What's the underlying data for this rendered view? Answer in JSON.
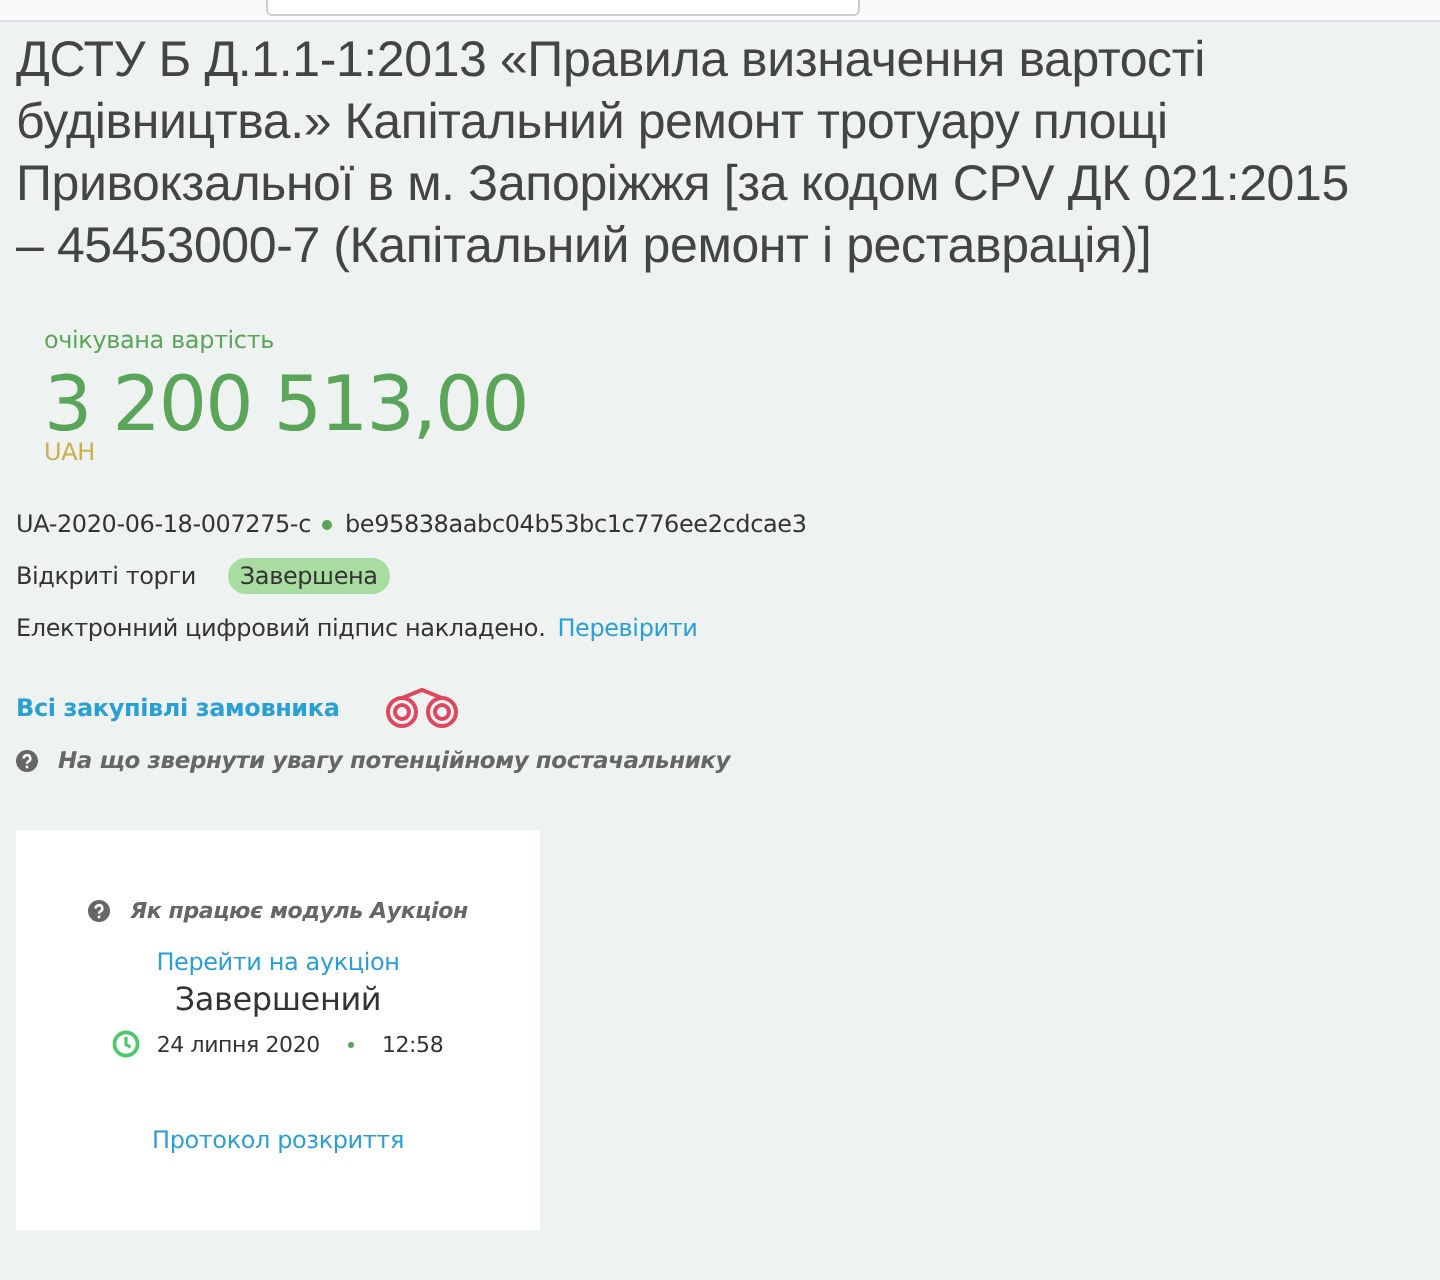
{
  "title": "ДСТУ Б Д.1.1-1:2013 «Правила визначення вартості будівництва.» Капітальний ремонт тротуару площі Привокзальної в м. Запоріжжя [за кодом CPV ДК 021:2015 – 45453000-7 (Капітальний ремонт і реставрація)]",
  "value": {
    "label": "очікувана вартість",
    "amount": "3 200 513,00",
    "currency": "UAH"
  },
  "tender_id": "UA-2020-06-18-007275-c",
  "hash": "be95838aabc04b53bc1c776ee2cdcae3",
  "procedure": "Відкриті торги",
  "status": "Завершена",
  "signature": {
    "text": "Електронний цифровий підпис накладено.",
    "link": "Перевірити"
  },
  "all_purchases_link": "Всі закупівлі замовника",
  "hint": "На що звернути увагу потенційному постачальнику",
  "auction": {
    "help": "Як працює модуль Аукціон",
    "link": "Перейти на аукціон",
    "state": "Завершений",
    "date": "24 липня 2020",
    "time": "12:58",
    "protocol_link": "Протокол розкриття"
  }
}
